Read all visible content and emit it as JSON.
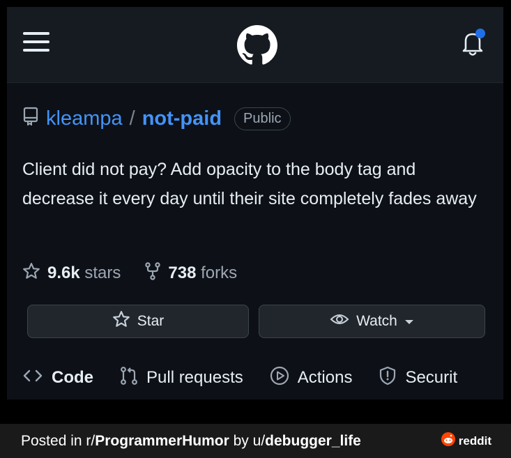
{
  "header": {
    "menu_icon": "hamburger-menu-icon",
    "logo_icon": "github-logo-icon",
    "notification_icon": "bell-icon",
    "notification_dot_color": "#1f6feb"
  },
  "repo": {
    "icon": "repo-icon",
    "owner": "kleampa",
    "separator": "/",
    "name": "not-paid",
    "visibility": "Public",
    "description": "Client did not pay? Add opacity to the body tag and decrease it every day until their site completely fades away",
    "stars_count": "9.6k",
    "stars_label": "stars",
    "forks_count": "738",
    "forks_label": "forks"
  },
  "actions": {
    "star_label": "Star",
    "watch_label": "Watch"
  },
  "tabs": [
    {
      "label": "Code",
      "icon": "code-icon"
    },
    {
      "label": "Pull requests",
      "icon": "pull-request-icon"
    },
    {
      "label": "Actions",
      "icon": "play-icon"
    },
    {
      "label": "Securit",
      "icon": "shield-icon"
    }
  ],
  "footer": {
    "posted_in": "Posted in r/",
    "subreddit": "ProgrammerHumor",
    "by": " by u/",
    "user": "debugger_life",
    "brand": "reddit"
  },
  "colors": {
    "link": "#4493f8",
    "background": "#0d1117",
    "header": "#161b22"
  }
}
